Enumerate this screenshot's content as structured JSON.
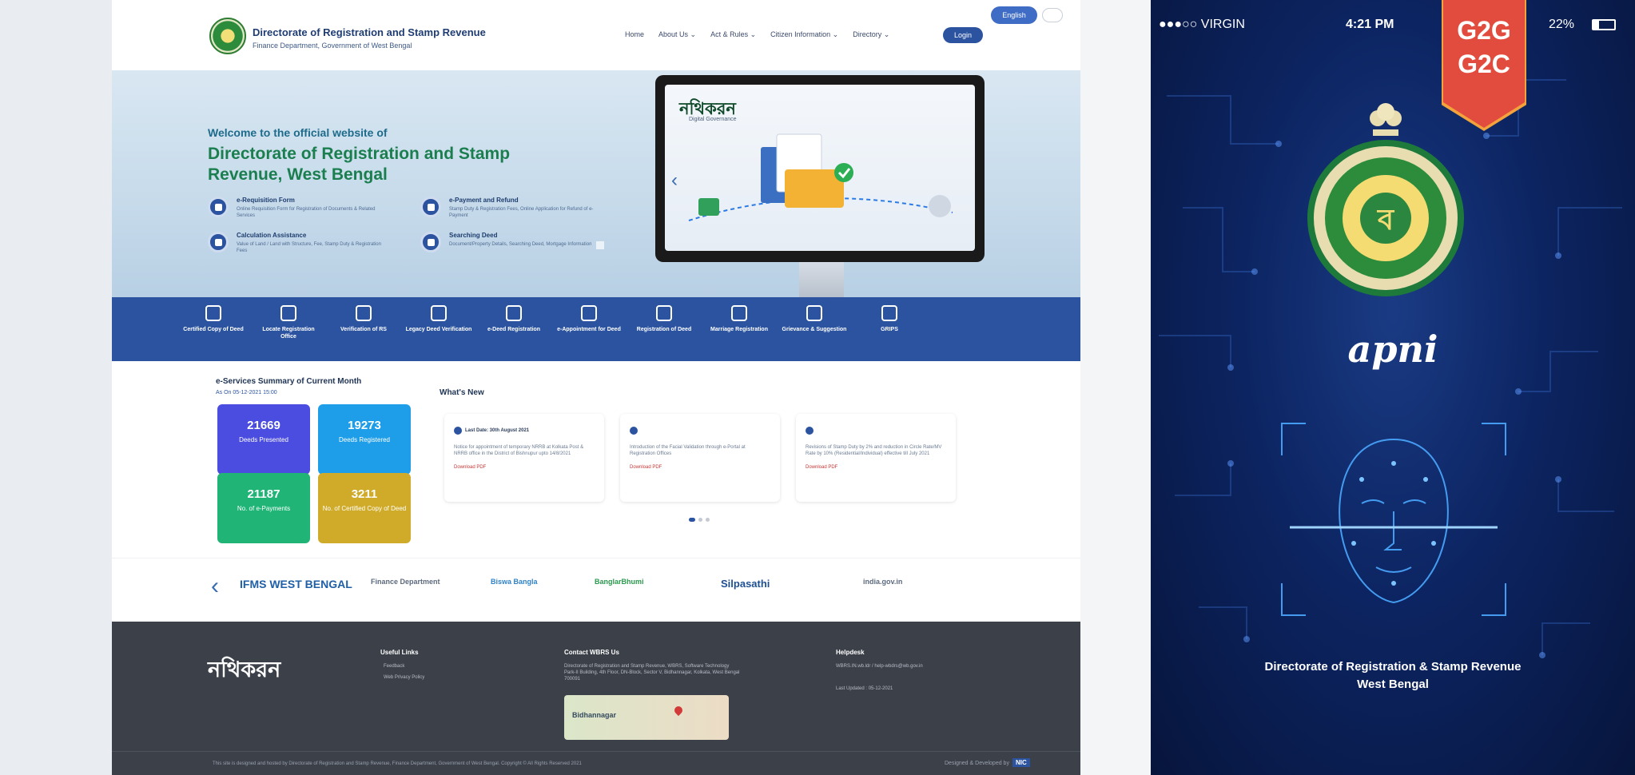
{
  "site": {
    "header": {
      "org_title": "Directorate of Registration and Stamp Revenue",
      "org_subtitle": "Finance Department, Government of West Bengal",
      "nav": [
        "Home",
        "About Us ⌄",
        "Act & Rules ⌄",
        "Citizen Information ⌄",
        "Directory ⌄"
      ],
      "login_label": "Login",
      "language_label": "English"
    },
    "hero": {
      "welcome": "Welcome to the official website of",
      "title": "Directorate of Registration and Stamp Revenue, West Bengal",
      "items": [
        {
          "title": "e-Requisition Form",
          "desc": "Online Requisition Form for Registration of Documents & Related Services"
        },
        {
          "title": "e-Payment and Refund",
          "desc": "Stamp Duty & Registration Fees, Online Application for Refund of e-Payment"
        },
        {
          "title": "Calculation Assistance",
          "desc": "Value of Land / Land with Structure, Fee, Stamp Duty & Registration Fees"
        },
        {
          "title": "Searching Deed",
          "desc": "Document/Property Details, Searching Deed, Mortgage Information"
        }
      ],
      "screen_brand": "নথিকরন",
      "screen_tagline": "Digital Governance"
    },
    "services": [
      "Certified Copy of Deed",
      "Locate Registration Office",
      "Verification of RS",
      "Legacy Deed Verification",
      "e-Deed Registration",
      "e-Appointment for Deed",
      "Registration of Deed",
      "Marriage Registration",
      "Grievance & Suggestion",
      "GRIPS"
    ],
    "summary": {
      "title": "e-Services Summary of Current Month",
      "date": "As On 05-12-2021 15:00",
      "tiles": [
        {
          "value": "21669",
          "label": "Deeds Presented",
          "color": "#4b4de0"
        },
        {
          "value": "19273",
          "label": "Deeds Registered",
          "color": "#1e9ee8"
        },
        {
          "value": "21187",
          "label": "No. of e-Payments",
          "color": "#20b577"
        },
        {
          "value": "3211",
          "label": "No. of Certified Copy of Deed",
          "color": "#d0ab2a"
        }
      ]
    },
    "whats_new": {
      "title": "What's New",
      "cards": [
        {
          "title": "Last Date: 30th August 2021",
          "body": "Notice for appointment of temporary NRRB at Kolkata Post & NRRB office in the District of Bishnupur upto 14/8/2021",
          "link": "Download PDF"
        },
        {
          "title": "",
          "body": "Introduction of the Facial Validation through e-Portal at Registration Offices",
          "link": "Download PDF"
        },
        {
          "title": "",
          "body": "Revisions of Stamp Duty by 2% and reduction in Circle Rate/MV Rate by 10% (Residential/Individual) effective till July 2021",
          "link": "Download PDF"
        }
      ]
    },
    "partners": [
      "IFMS WEST BENGAL",
      "Finance Department",
      "Biswa Bangla",
      "BanglarBhumi",
      "Silpasathi",
      "india.gov.in"
    ],
    "footer": {
      "brand": "নথিকরন",
      "useful_links_title": "Useful Links",
      "useful_links": [
        "Feedback",
        "Web Privacy Policy"
      ],
      "contact_title": "Contact WBRS Us",
      "contact_text": "Directorate of Registration and Stamp Revenue, WBRS, Software Technology Park-II Building, 4th Floor, DN-Block, Sector V, Bidhannagar, Kolkata, West Bengal 700091",
      "map_label": "Bidhannagar",
      "helpdesk_title": "Helpdesk",
      "helpdesk_text": "WBRS.IN.wb.ldr / help-wbdrs@wb.gov.in",
      "last_updated": "Last Updated : 05-12-2021",
      "copyright": "This site is designed and hosted by Directorate of Registration and Stamp Revenue, Finance Department, Government of West Bengal. Copyright © All Rights Reserved 2021",
      "nic": "Designed & Developed by",
      "nic_badge": "NIC"
    }
  },
  "phone": {
    "status": {
      "carrier": "●●●○○ VIRGIN",
      "time": "4:21 PM",
      "battery": "22%"
    },
    "ribbon": [
      "G2G",
      "G2C"
    ],
    "app_name": "apni",
    "caption_line1": "Directorate of Registration & Stamp Revenue",
    "caption_line2": "West Bengal"
  }
}
